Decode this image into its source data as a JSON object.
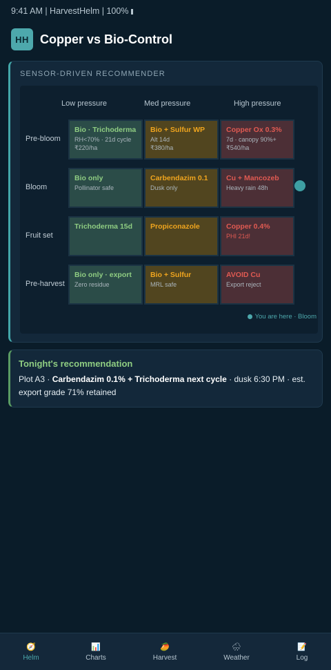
{
  "status_bar": {
    "text": "9:41 AM | HarvestHelm | 100%"
  },
  "header": {
    "avatar": "HH",
    "title": "Copper vs Bio-Control"
  },
  "recommender": {
    "title": "SENSOR-DRIVEN RECOMMENDER",
    "columns": [
      "Low pressure",
      "Med pressure",
      "High pressure"
    ],
    "rows": [
      {
        "label": "Pre-bloom",
        "cells": [
          {
            "title": "Bio · Trichoderma",
            "lines": [
              "RH<70% · 21d cycle",
              "₹220/ha"
            ],
            "color": "green"
          },
          {
            "title": "Bio + Sulfur WP",
            "lines": [
              "Alt 14d",
              "₹380/ha"
            ],
            "color": "orange"
          },
          {
            "title": "Copper Ox 0.3%",
            "lines": [
              "7d · canopy 90%+",
              "₹540/ha"
            ],
            "color": "red"
          }
        ]
      },
      {
        "label": "Bloom",
        "cells": [
          {
            "title": "Bio only",
            "lines": [
              "Pollinator safe"
            ],
            "color": "green"
          },
          {
            "title": "Carbendazim 0.1",
            "lines": [
              "Dusk only"
            ],
            "color": "orange"
          },
          {
            "title": "Cu + Mancozeb",
            "lines": [
              "Heavy rain 48h"
            ],
            "color": "red"
          }
        ]
      },
      {
        "label": "Fruit set",
        "cells": [
          {
            "title": "Trichoderma 15d",
            "lines": [],
            "color": "green"
          },
          {
            "title": "Propiconazole",
            "lines": [],
            "color": "orange"
          },
          {
            "title": "Copper 0.4%",
            "lines": [
              "PHI 21d!"
            ],
            "color": "red"
          }
        ]
      },
      {
        "label": "Pre-harvest",
        "cells": [
          {
            "title": "Bio only · export",
            "lines": [
              "Zero residue"
            ],
            "color": "green"
          },
          {
            "title": "Bio + Sulfur",
            "lines": [
              "MRL safe"
            ],
            "color": "orange"
          },
          {
            "title": "AVOID Cu",
            "lines": [
              "Export reject"
            ],
            "color": "red"
          }
        ]
      }
    ],
    "current_stage": "Bloom",
    "legend": "You are here · Bloom"
  },
  "recommendation": {
    "title": "Tonight's recommendation",
    "prefix": "Plot A3 · ",
    "bold": "Carbendazim 0.1% + Trichoderma next cycle",
    "suffix": " · dusk 6:30 PM · est. export grade 71% retained"
  },
  "tabs": [
    {
      "label": "Helm",
      "icon": "🧭",
      "icon_name": "compass-icon",
      "active": true
    },
    {
      "label": "Charts",
      "icon": "📊",
      "icon_name": "bar-chart-icon",
      "active": false
    },
    {
      "label": "Harvest",
      "icon": "🥭",
      "icon_name": "mango-icon",
      "active": false
    },
    {
      "label": "Weather",
      "icon": "🌧",
      "icon_name": "rain-cloud-icon",
      "active": false
    },
    {
      "label": "Log",
      "icon": "📝",
      "icon_name": "memo-icon",
      "active": false
    }
  ],
  "colors": {
    "accent": "#4da8ac",
    "low": "#8fcd82",
    "med": "#f0a51e",
    "high": "#e05a52",
    "background": "#0a1c29"
  }
}
